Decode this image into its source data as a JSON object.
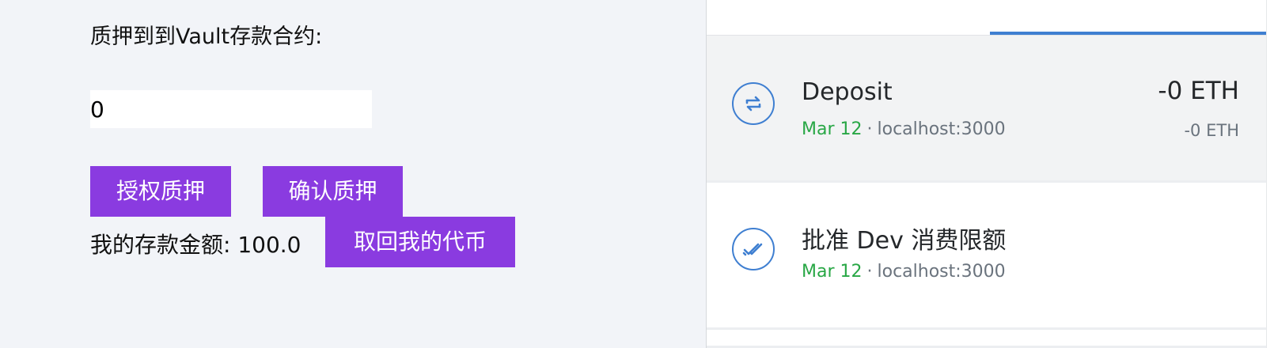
{
  "dapp": {
    "title": "质押到到Vault存款合约:",
    "amount_value": "0",
    "approve_button": "授权质押",
    "confirm_button": "确认质押",
    "deposit_label": "我的存款金额: 100.0",
    "withdraw_button": "取回我的代币",
    "accent_color": "#8a3be0"
  },
  "wallet": {
    "active_tab_color": "#3f7fd1",
    "transactions": [
      {
        "icon": "swap-arrows-icon",
        "title": "Deposit",
        "date": "Mar 12",
        "separator": "·",
        "origin": "localhost:3000",
        "amount": "-0 ETH",
        "subamount": "-0 ETH"
      },
      {
        "icon": "double-check-icon",
        "title": "批准 Dev 消费限额",
        "date": "Mar 12",
        "separator": "·",
        "origin": "localhost:3000"
      }
    ]
  }
}
